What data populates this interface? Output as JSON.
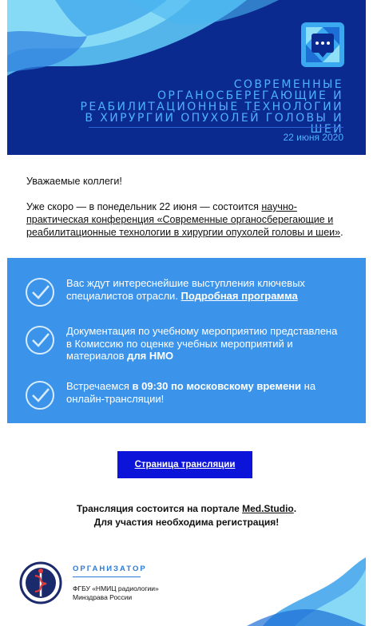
{
  "header": {
    "title": "Современные органосберегающие и реабилитационные технологии в хирургии опухолей головы и шеи",
    "date": "22 июня 2020",
    "colors": {
      "background": "#0a2a8f",
      "accent": "#4fb0ff"
    }
  },
  "intro": {
    "greeting": "Уважаемые коллеги!",
    "text_before": "Уже скоро — в понедельник 22 июня — состоится ",
    "conference_link": "научно-практическая конференция «Современные органосберегающие и реабилитационные технологии в хирургии опухолей головы и шеи»",
    "text_after": "."
  },
  "highlights": [
    {
      "icon": "check-circle-icon",
      "text": "Вас ждут интереснейшие выступления ключевых специалистов отрасли. ",
      "bold": "Подробная программа"
    },
    {
      "icon": "check-circle-icon",
      "text": "Документация по учебному мероприятию представлена в Комиссию по оценке учебных мероприятий и материалов ",
      "bold": "для НМО"
    },
    {
      "icon": "check-circle-icon",
      "text_before": "Встречаемся ",
      "bold": "в 09:30 по московскому времени",
      "text_after": " на онлайн-трансляции!"
    }
  ],
  "button": {
    "label": "Страница трансляции"
  },
  "footer": {
    "line1_before": "Трансляция состоится на портале ",
    "portal": "Med.Studio",
    "line1_after": ".",
    "line2": "Для участия необходима регистрация!"
  },
  "organizer": {
    "label": "ОРГАНИЗАТОР",
    "name_line1": "ФГБУ «НМИЦ радиологии»",
    "name_line2": "Минздрава России"
  }
}
